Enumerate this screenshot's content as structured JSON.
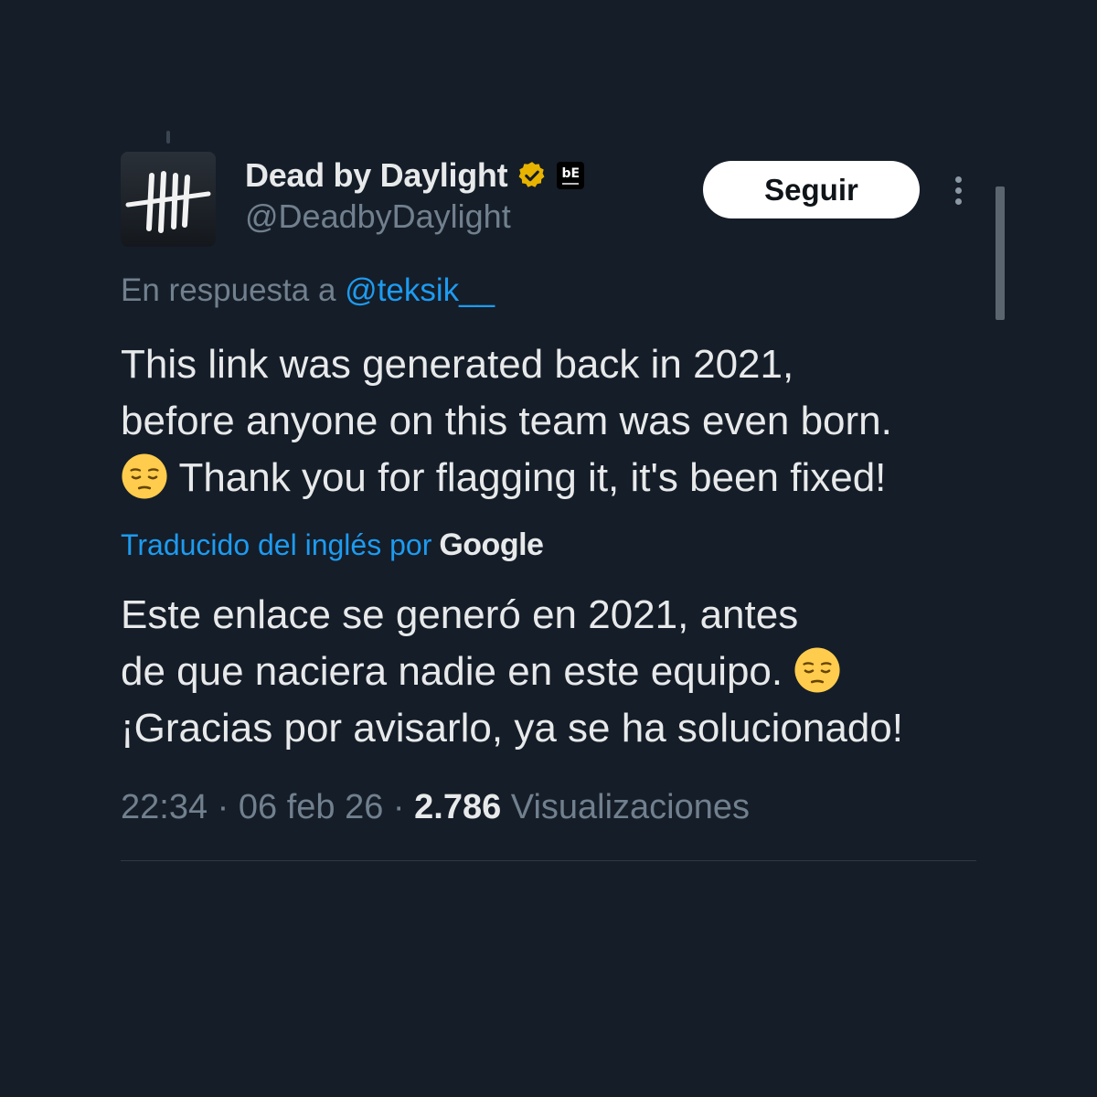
{
  "author": {
    "display_name": "Dead by Daylight",
    "handle": "@DeadbyDaylight",
    "verified_badge": "verified-gold-icon",
    "affiliate_badge": "bE"
  },
  "follow_button_label": "Seguir",
  "reply_to": {
    "prefix": "En respuesta a",
    "mention": "@teksik__"
  },
  "tweet": {
    "lines": [
      "This link was generated back in 2021,",
      "before anyone on this team was even born.",
      "Thank you for flagging it, it's been fixed!"
    ],
    "emoji": "pensive-face"
  },
  "translation": {
    "label": "Traducido del inglés por",
    "provider": "Google",
    "lines": [
      "Este enlace se generó en 2021, antes",
      "de que naciera nadie en este equipo.",
      "¡Gracias por avisarlo, ya se ha solucionado!"
    ]
  },
  "meta": {
    "time": "22:34",
    "separator": " · ",
    "date": "06 feb 26",
    "views_count": "2.786",
    "views_label": "Visualizaciones"
  },
  "colors": {
    "background": "#151d28",
    "text": "#e7e9ea",
    "muted": "#71808e",
    "link": "#1d9bf0",
    "verified": "#e8b400"
  }
}
